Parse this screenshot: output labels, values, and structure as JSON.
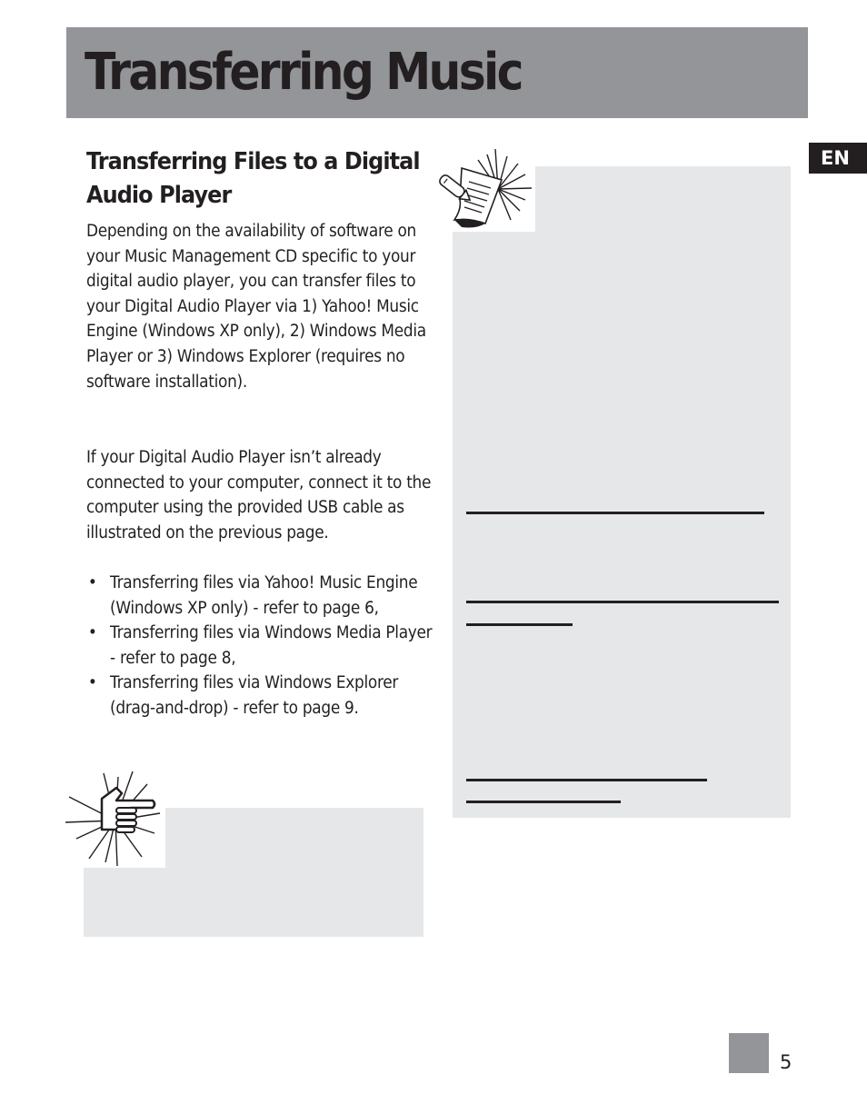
{
  "header": {
    "title": "Transferring Music",
    "bar_color": "#939598"
  },
  "language_tab": {
    "label": "EN"
  },
  "section": {
    "title": "Transferring Files to a Digital Audio Player",
    "paragraphs": [
      "Depending on the availability of software on your Music Management CD specific to your digital audio player, you can transfer files to your Digital Audio Player via 1) Yahoo! Music Engine (Windows XP only), 2) Windows Media Player or 3) Windows Explorer (requires no software installation).",
      "If your Digital Audio Player isn’t already connected to your computer, connect it to the computer using the provided USB cable as illustrated on the previous page."
    ],
    "bullets": [
      "Transferring files via Yahoo! Music Engine (Windows XP only) - refer to page 6,",
      "Transferring files via Windows Media Player - refer to page 8,",
      "Transferring files via Windows Explorer (drag-and-drop) - refer to page 9."
    ],
    "bullet_glyph": "•"
  },
  "note_box": {
    "icon": "note-pencil-icon",
    "background": "#e6e7e8"
  },
  "tip_box": {
    "icon": "pointing-hand-icon",
    "background": "#e6e7e8"
  },
  "footer": {
    "page_number": "5"
  }
}
